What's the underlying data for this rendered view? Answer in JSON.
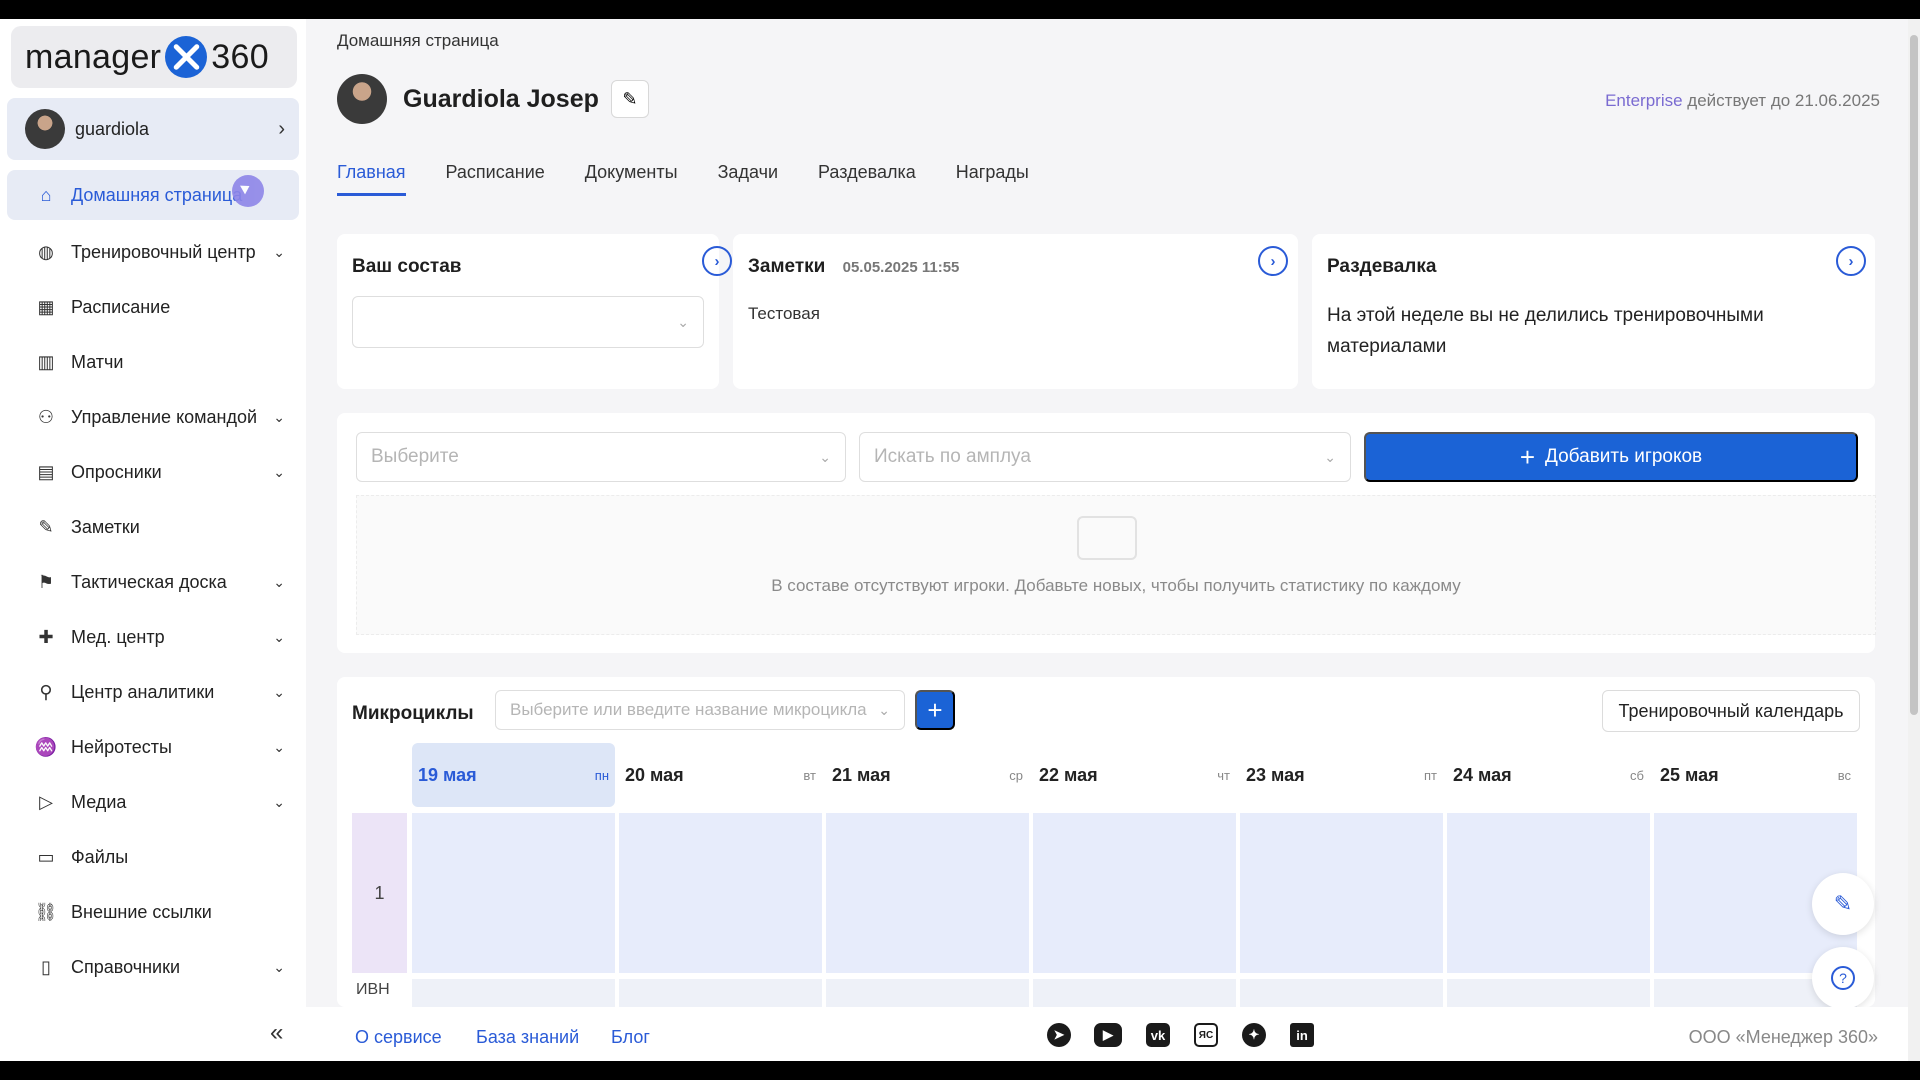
{
  "app": {
    "logo_text_left": "manager",
    "logo_text_right": "360"
  },
  "user": {
    "username": "guardiola"
  },
  "sidebar": {
    "items": [
      {
        "label": "Домашняя страница",
        "icon": "home-icon",
        "has_dropdown": false
      },
      {
        "label": "Тренировочный центр",
        "icon": "ball-icon",
        "has_dropdown": true
      },
      {
        "label": "Расписание",
        "icon": "calendar-icon",
        "has_dropdown": false
      },
      {
        "label": "Матчи",
        "icon": "scoreboard-icon",
        "has_dropdown": false
      },
      {
        "label": "Управление командой",
        "icon": "team-icon",
        "has_dropdown": true
      },
      {
        "label": "Опросники",
        "icon": "survey-icon",
        "has_dropdown": true
      },
      {
        "label": "Заметки",
        "icon": "pen-icon",
        "has_dropdown": false
      },
      {
        "label": "Тактическая доска",
        "icon": "tactics-icon",
        "has_dropdown": true
      },
      {
        "label": "Мед. центр",
        "icon": "medkit-icon",
        "has_dropdown": true
      },
      {
        "label": "Центр аналитики",
        "icon": "analytics-icon",
        "has_dropdown": true
      },
      {
        "label": "Нейротесты",
        "icon": "neuro-icon",
        "has_dropdown": true
      },
      {
        "label": "Медиа",
        "icon": "play-icon",
        "has_dropdown": true
      },
      {
        "label": "Файлы",
        "icon": "folder-icon",
        "has_dropdown": false
      },
      {
        "label": "Внешние ссылки",
        "icon": "link-icon",
        "has_dropdown": false
      },
      {
        "label": "Справочники",
        "icon": "book-icon",
        "has_dropdown": true
      }
    ],
    "collapse_label": "«"
  },
  "header": {
    "breadcrumb": "Домашняя страница",
    "profile_name": "Guardiola Josep",
    "license_plan": "Enterprise",
    "license_text": "действует до 21.06.2025"
  },
  "tabs": [
    "Главная",
    "Расписание",
    "Документы",
    "Задачи",
    "Раздевалка",
    "Награды"
  ],
  "cards": {
    "squad": {
      "title": "Ваш состав",
      "select_value": ""
    },
    "notes": {
      "title": "Заметки",
      "date": "05.05.2025 11:55",
      "body": "Тестовая"
    },
    "locker": {
      "title": "Раздевалка",
      "body": "На этой неделе вы не делились тренировочными материалами"
    }
  },
  "players": {
    "select_placeholder": "Выберите",
    "position_placeholder": "Искать по амплуа",
    "add_button": "Добавить игроков",
    "empty_text": "В составе отсутствуют игроки. Добавьте новых, чтобы получить статистику по каждому"
  },
  "microcycles": {
    "title": "Микроциклы",
    "select_placeholder": "Выберите или введите название микроцикла",
    "calendar_button": "Тренировочный календарь",
    "week_number": "1",
    "next_row_label": "ИВН",
    "days": [
      {
        "date": "19 мая",
        "weekday": "пн",
        "today": true
      },
      {
        "date": "20 мая",
        "weekday": "вт",
        "today": false
      },
      {
        "date": "21 мая",
        "weekday": "ср",
        "today": false
      },
      {
        "date": "22 мая",
        "weekday": "чт",
        "today": false
      },
      {
        "date": "23 мая",
        "weekday": "пт",
        "today": false
      },
      {
        "date": "24 мая",
        "weekday": "сб",
        "today": false
      },
      {
        "date": "25 мая",
        "weekday": "вс",
        "today": false
      }
    ]
  },
  "footer": {
    "links": [
      "О сервисе",
      "База знаний",
      "Блог"
    ],
    "social": [
      "telegram-icon",
      "youtube-icon",
      "vk-icon",
      "yandex-zen-icon",
      "dzen-icon",
      "linkedin-icon"
    ],
    "copyright": "ООО «Менеджер 360»"
  },
  "colors": {
    "accent": "#1b63d6",
    "active_nav_bg": "#e7ebf5",
    "today_bg": "#dde6f7",
    "cell_bg": "#e7ecfb",
    "license_plan": "#7a6bd1"
  }
}
